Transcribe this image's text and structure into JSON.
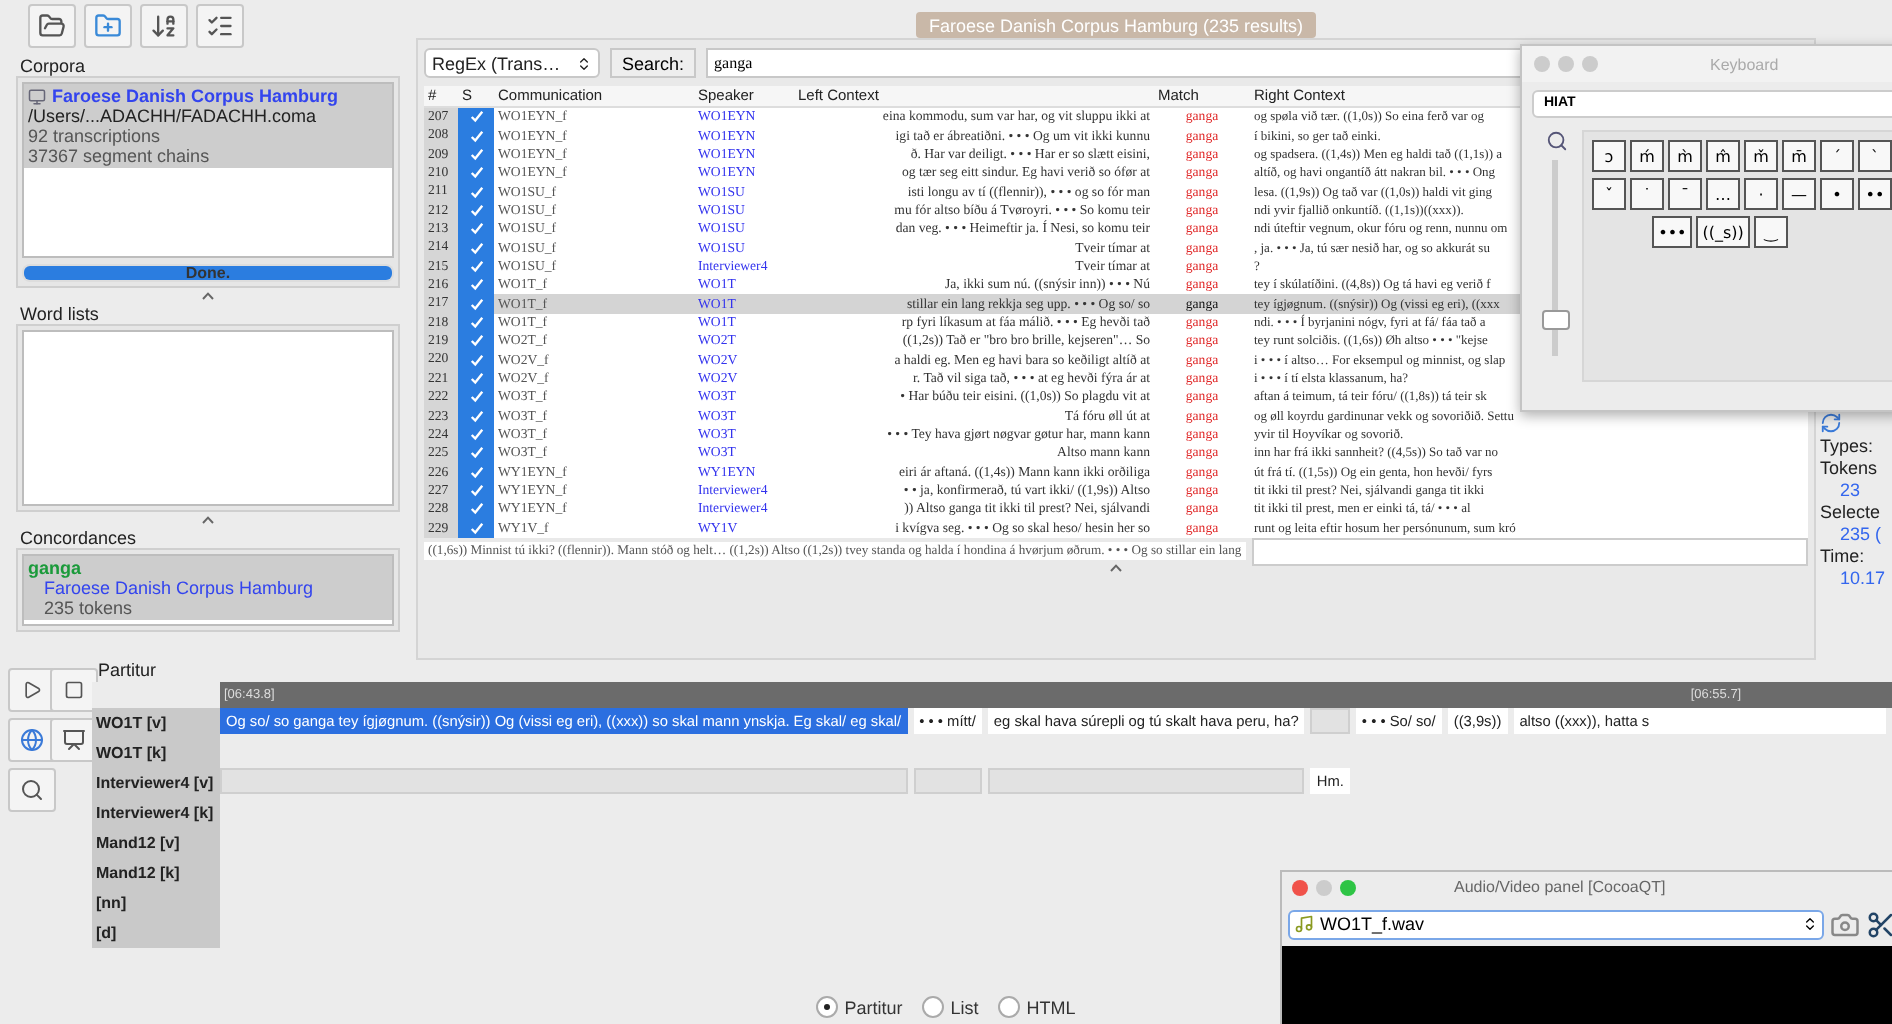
{
  "corpora": {
    "title": "Corpora",
    "items": [
      {
        "name": "Faroese Danish Corpus Hamburg",
        "path": "/Users/...ADACHH/FADACHH.coma",
        "transcriptions": "92 transcriptions",
        "chains": "37367 segment chains",
        "selected": true
      }
    ],
    "progress": {
      "label": "Done.",
      "level": 1
    }
  },
  "word_lists": {
    "title": "Word lists"
  },
  "concordances": {
    "title": "Concordances",
    "items": [
      {
        "query": "ganga",
        "corpus": "Faroese Danish Corpus Hamburg",
        "tokens": "235 tokens",
        "selected": true
      }
    ]
  },
  "results_tab": "Faroese Danish Corpus Hamburg (235 results)",
  "search": {
    "mode": "RegEx (Trans…",
    "button": "Search:",
    "value": "ganga"
  },
  "table": {
    "columns": [
      "#",
      "S",
      "Communication",
      "Speaker",
      "Left Context",
      "Match",
      "Right Context"
    ],
    "rows": [
      {
        "n": "207",
        "checked": true,
        "selected": false,
        "communication": "WO1EYN_f",
        "speaker": "WO1EYN",
        "left": "eina kommodu, sum var har, og vit sluppu ikki at",
        "match": "ganga",
        "right": "og spøla við tær. ((1,0s)) So eina ferð var og"
      },
      {
        "n": "208",
        "checked": true,
        "selected": false,
        "communication": "WO1EYN_f",
        "speaker": "WO1EYN",
        "left": "igi tað er ábreatiðni. • • • Og um vit ikki kunnu",
        "match": "ganga",
        "right": "í bikini, so ger tað einki."
      },
      {
        "n": "209",
        "checked": true,
        "selected": false,
        "communication": "WO1EYN_f",
        "speaker": "WO1EYN",
        "left": "ð. Har var deiligt. • • • Har er so slætt eisini,",
        "match": "ganga",
        "right": "og spadsera. ((1,4s)) Men eg haldi tað ((1,1s)) a"
      },
      {
        "n": "210",
        "checked": true,
        "selected": false,
        "communication": "WO1EYN_f",
        "speaker": "WO1EYN",
        "left": "og tær seg eitt sindur. Eg havi verið so ófør at",
        "match": "ganga",
        "right": "altíð, og havi ongantíð átt nakran bil. • • • Ong"
      },
      {
        "n": "211",
        "checked": true,
        "selected": false,
        "communication": "WO1SU_f",
        "speaker": "WO1SU",
        "left": "isti longu av tí ((flennir)), • • • og so fór man",
        "match": "ganga",
        "right": "lesa. ((1,9s)) Og tað var ((1,0s)) haldi vit ging"
      },
      {
        "n": "212",
        "checked": true,
        "selected": false,
        "communication": "WO1SU_f",
        "speaker": "WO1SU",
        "left": "mu fór altso bíðu á Tvøroyri. • • • So komu teir",
        "match": "ganga",
        "right": "ndi yvir fjallið onkuntíð. ((1,1s))((xxx))."
      },
      {
        "n": "213",
        "checked": true,
        "selected": false,
        "communication": "WO1SU_f",
        "speaker": "WO1SU",
        "left": "dan veg. • • • Heimeftir ja. Í Nesi, so komu teir",
        "match": "ganga",
        "right": "ndi úteftir vegnum, okur fóru og renn, nunnu om"
      },
      {
        "n": "214",
        "checked": true,
        "selected": false,
        "communication": "WO1SU_f",
        "speaker": "WO1SU",
        "left": "Tveir tímar at",
        "match": "ganga",
        "right": ", ja. • • • Ja, tú sær nesið har, og so akkurát su"
      },
      {
        "n": "215",
        "checked": true,
        "selected": false,
        "communication": "WO1SU_f",
        "speaker": "Interviewer4",
        "left": "Tveir tímar at",
        "match": "ganga",
        "right": "?"
      },
      {
        "n": "216",
        "checked": true,
        "selected": false,
        "communication": "WO1T_f",
        "speaker": "WO1T",
        "left": "Ja, ikki sum nú. ((snýsir inn)) • • • Nú",
        "match": "ganga",
        "right": "tey í skúlatíðini. ((4,8s)) Og tá havi eg verið f"
      },
      {
        "n": "217",
        "checked": true,
        "selected": true,
        "communication": "WO1T_f",
        "speaker": "WO1T",
        "left": "stillar ein lang rekkja seg upp. • • • Og so/ so",
        "match": "ganga",
        "right": "tey ígjøgnum. ((snýsir)) Og (vissi eg eri), ((xxx"
      },
      {
        "n": "218",
        "checked": true,
        "selected": false,
        "communication": "WO1T_f",
        "speaker": "WO1T",
        "left": "rp fyri líkasum at fáa málið. • • • Eg hevði tað",
        "match": "ganga",
        "right": "ndi. • • • Í byrjanini nógv, fyri at fá/ fáa tað a"
      },
      {
        "n": "219",
        "checked": true,
        "selected": false,
        "communication": "WO2T_f",
        "speaker": "WO2T",
        "left": "((1,2s)) Tað er \"bro bro brille, kejseren\"… So",
        "match": "ganga",
        "right": "tey runt solciðis. ((1,6s)) Øh altso • • • \"kejse"
      },
      {
        "n": "220",
        "checked": true,
        "selected": false,
        "communication": "WO2V_f",
        "speaker": "WO2V",
        "left": "a haldi eg. Men eg havi bara so keðiligt altíð at",
        "match": "ganga",
        "right": "i • • • í altso… For eksempul og minnist, og slap"
      },
      {
        "n": "221",
        "checked": true,
        "selected": false,
        "communication": "WO2V_f",
        "speaker": "WO2V",
        "left": "r. Tað vil siga tað, • • • at eg hevði fýra ár at",
        "match": "ganga",
        "right": "i • • • í tí elsta klassanum, ha?"
      },
      {
        "n": "222",
        "checked": true,
        "selected": false,
        "communication": "WO3T_f",
        "speaker": "WO3T",
        "left": "• Har búðu teir eisini. ((1,0s)) So plagdu vit at",
        "match": "ganga",
        "right": "aftan á teimum, tá teir fóru/ ((1,8s)) tá teir sk"
      },
      {
        "n": "223",
        "checked": true,
        "selected": false,
        "communication": "WO3T_f",
        "speaker": "WO3T",
        "left": "Tá fóru øll út at",
        "match": "ganga",
        "right": "og øll koyrdu gardinunar vekk og sovoriðið. Settu"
      },
      {
        "n": "224",
        "checked": true,
        "selected": false,
        "communication": "WO3T_f",
        "speaker": "WO3T",
        "left": "• • • Tey hava gjørt nøgvar gøtur har, mann kann",
        "match": "ganga",
        "right": "yvir til Hoyvíkar og sovorið."
      },
      {
        "n": "225",
        "checked": true,
        "selected": false,
        "communication": "WO3T_f",
        "speaker": "WO3T",
        "left": "Altso mann kann",
        "match": "ganga",
        "right": "inn har frá ikki sannheit? ((4,5s)) So tað var no"
      },
      {
        "n": "226",
        "checked": true,
        "selected": false,
        "communication": "WY1EYN_f",
        "speaker": "WY1EYN",
        "left": "eiri ár aftaná. ((1,4s)) Mann kann ikki orðiliga",
        "match": "ganga",
        "right": "út frá tí. ((1,5s)) Og ein genta, hon hevði/ fyrs"
      },
      {
        "n": "227",
        "checked": true,
        "selected": false,
        "communication": "WY1EYN_f",
        "speaker": "Interviewer4",
        "left": "• • ja, konfirmerað, tú vart ikki/ ((1,9s)) Altso",
        "match": "ganga",
        "right": "tit ikki til prest? Nei, sjálvandi ganga tit ikki"
      },
      {
        "n": "228",
        "checked": true,
        "selected": false,
        "communication": "WY1EYN_f",
        "speaker": "Interviewer4",
        "left": ")) Altso ganga tit ikki til prest? Nei, sjálvandi",
        "match": "ganga",
        "right": "tit ikki til prest, men er einki tá, tá/ • • • al"
      },
      {
        "n": "229",
        "checked": true,
        "selected": false,
        "communication": "WY1V_f",
        "speaker": "WY1V",
        "left": "i kvígva seg. • • • Og so skal heso/ hesin her so",
        "match": "ganga",
        "right": "runt og leita eftir hosum her persónunum, sum kró"
      }
    ]
  },
  "context_line": "((1,6s)) Minnist tú ikki? ((flennir)). Mann stóð og helt… ((1,2s)) Altso ((1,2s)) tvey standa og halda í hondina á hvørjum øðrum. • • • Og so stillar ein lang",
  "stats": [
    {
      "label": "Types:"
    },
    {
      "label": "Tokens"
    },
    {
      "value": "23"
    },
    {
      "label": "Selecte"
    },
    {
      "value": "235 ("
    },
    {
      "label": "Time:"
    },
    {
      "value": "10.17"
    }
  ],
  "partitur": {
    "title": "Partitur",
    "timeline": [
      {
        "time": "[06:43.8]"
      },
      {
        "time": "[06:55.7]"
      }
    ],
    "tiers": [
      {
        "label": "WO1T [v]",
        "cells": [
          {
            "text": "Og so/ so ganga tey ígjøgnum. ((snýsir)) Og (vissi eg eri), ((xxx)) so skal mann ynskja. Eg skal/ eg skal/",
            "selected": true
          },
          {
            "text": "• • • mítt/",
            "selected": false
          },
          {
            "text": "eg skal hava súrepli og tú skalt hava peru, ha?",
            "selected": false
          },
          {
            "empty": true
          },
          {
            "text": "• • • So/ so/",
            "selected": false
          },
          {
            "text": "((3,9s))",
            "selected": false
          },
          {
            "text": "altso ((xxx)), hatta s",
            "selected": false
          }
        ]
      },
      {
        "label": "WO1T [k]"
      },
      {
        "label": "Interviewer4 [v]",
        "cells": [
          {
            "empty": true
          },
          {
            "empty": true
          },
          {
            "empty": true
          },
          {
            "text": "Hm.",
            "selected": false
          }
        ]
      },
      {
        "label": "Interviewer4 [k]"
      },
      {
        "label": "Mand12 [v]"
      },
      {
        "label": "Mand12 [k]"
      },
      {
        "label": "[nn]"
      },
      {
        "label": "[d]"
      }
    ]
  },
  "views": [
    {
      "label": "Partitur",
      "selected": true
    },
    {
      "label": "List",
      "selected": false
    },
    {
      "label": "HTML",
      "selected": false
    }
  ],
  "keyboard": {
    "title": "Keyboard",
    "layout": "HIAT",
    "zoom": {
      "level": 0.15
    },
    "rows": [
      [
        "ɔ",
        "ḿ",
        "m̀",
        "m̂",
        "m̌",
        "m̄",
        "ˊ",
        "ˋ"
      ],
      [
        "ˇ",
        "˙",
        "ˉ",
        "…",
        "·",
        "—",
        "•",
        "••"
      ]
    ],
    "extra_keys": [
      "•••",
      "((_s))",
      "‿"
    ]
  },
  "av_panel": {
    "title": "Audio/Video panel [CocoaQT]",
    "file": "WO1T_f.wav"
  }
}
